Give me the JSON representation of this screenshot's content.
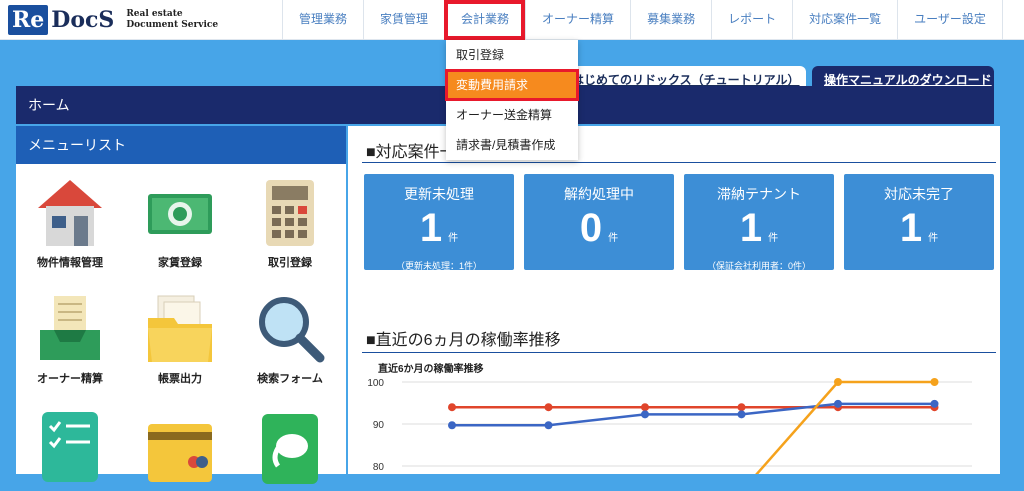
{
  "logo": {
    "re": "Re",
    "docs": "DocS",
    "sub_line1": "Real estate",
    "sub_line2": "Document Service"
  },
  "nav": [
    {
      "label": "管理業務"
    },
    {
      "label": "家賃管理"
    },
    {
      "label": "会計業務"
    },
    {
      "label": "オーナー精算"
    },
    {
      "label": "募集業務"
    },
    {
      "label": "レポート"
    },
    {
      "label": "対応案件一覧"
    },
    {
      "label": "ユーザー設定"
    }
  ],
  "dropdown": [
    {
      "label": "取引登録"
    },
    {
      "label": "変動費用請求"
    },
    {
      "label": "オーナー送金精算"
    },
    {
      "label": "請求書/見積書作成"
    }
  ],
  "tabs": {
    "tutorial": "はじめてのリドックス（チュートリアル）",
    "manual": "操作マニュアルのダウンロード"
  },
  "home_title": "ホーム",
  "menu": {
    "title": "メニューリスト",
    "items": [
      {
        "label": "物件情報管理",
        "icon": "house-icon"
      },
      {
        "label": "家賃登録",
        "icon": "money-icon"
      },
      {
        "label": "取引登録",
        "icon": "calculator-icon"
      },
      {
        "label": "オーナー精算",
        "icon": "inbox-tray-icon"
      },
      {
        "label": "帳票出力",
        "icon": "folder-icon"
      },
      {
        "label": "検索フォーム",
        "icon": "magnifier-icon"
      },
      {
        "label": "",
        "icon": "checklist-icon"
      },
      {
        "label": "",
        "icon": "credit-card-icon"
      },
      {
        "label": "",
        "icon": "elephant-icon"
      }
    ]
  },
  "cases": {
    "title": "■対応案件一覧",
    "cards": [
      {
        "title": "更新未処理",
        "value": "1",
        "unit": "件",
        "note": "（更新未処理：1件）"
      },
      {
        "title": "解約処理中",
        "value": "0",
        "unit": "件",
        "note": ""
      },
      {
        "title": "滞納テナント",
        "value": "1",
        "unit": "件",
        "note": "（保証会社利用者：0件）"
      },
      {
        "title": "対応未完了",
        "value": "1",
        "unit": "件",
        "note": ""
      }
    ]
  },
  "occupancy": {
    "title": "■直近の6ヵ月の稼働率推移"
  },
  "chart_data": {
    "type": "line",
    "title": "直近6か月の稼働率推移",
    "x": [
      1,
      2,
      3,
      4,
      5,
      6
    ],
    "ylim": [
      80,
      100
    ],
    "yticks": [
      "100",
      "90",
      "80"
    ],
    "grid": true,
    "series": [
      {
        "color": "#e0452b",
        "values": [
          94,
          94,
          94,
          94,
          94,
          94
        ]
      },
      {
        "color": "#3b66c4",
        "values": [
          89.7,
          89.7,
          92.3,
          92.3,
          94.8,
          94.8
        ]
      },
      {
        "color": "#f5a21c",
        "values": [
          null,
          null,
          null,
          null,
          100,
          100
        ]
      }
    ]
  }
}
